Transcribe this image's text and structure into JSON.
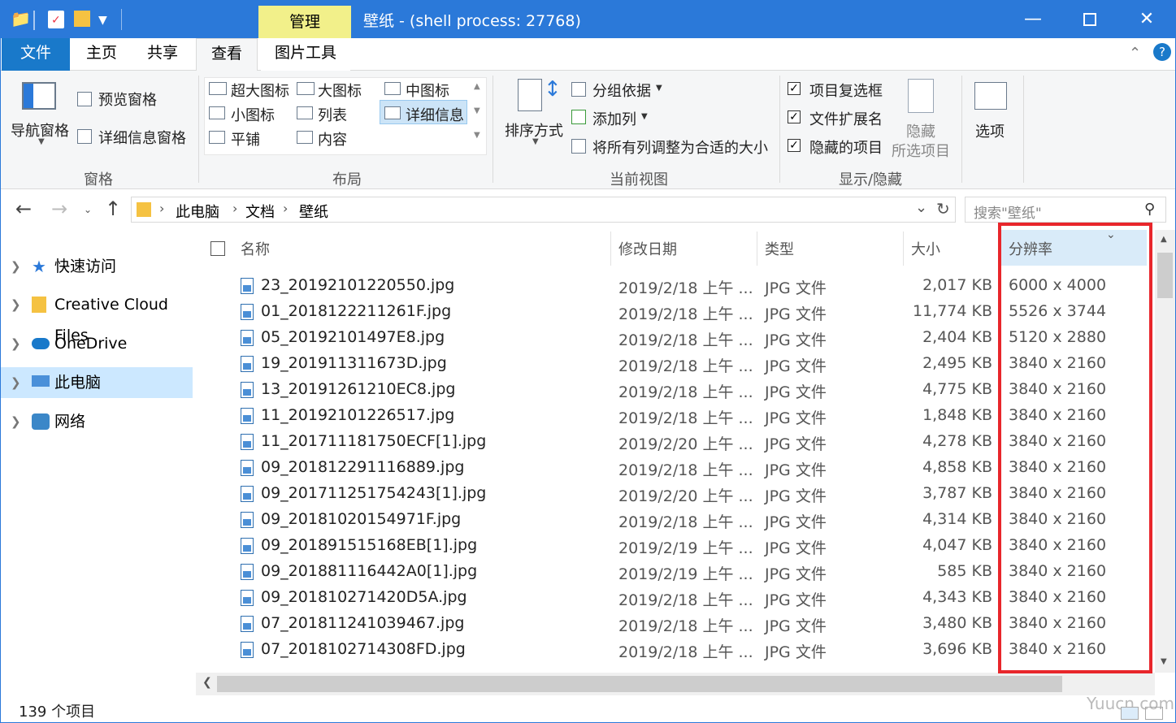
{
  "window": {
    "title": "壁纸 - (shell process: 27768)",
    "context_tab": "管理"
  },
  "tabs": [
    "文件",
    "主页",
    "共享",
    "查看",
    "图片工具"
  ],
  "ribbon": {
    "pane_group": {
      "nav_pane": "导航窗格",
      "preview_pane": "预览窗格",
      "details_pane": "详细信息窗格",
      "label": "窗格"
    },
    "layout_group": {
      "items": [
        "超大图标",
        "大图标",
        "中图标",
        "小图标",
        "列表",
        "详细信息",
        "平铺",
        "内容"
      ],
      "label": "布局"
    },
    "current_view_group": {
      "sort_by": "排序方式",
      "group_by": "分组依据",
      "add_columns": "添加列",
      "size_all_columns": "将所有列调整为合适的大小",
      "label": "当前视图"
    },
    "show_hide_group": {
      "item_checkboxes": "项目复选框",
      "file_extensions": "文件扩展名",
      "hidden_items": "隐藏的项目",
      "hide_selected_line1": "隐藏",
      "hide_selected_line2": "所选项目",
      "label": "显示/隐藏"
    },
    "options": "选项"
  },
  "address": {
    "breadcrumb": [
      "此电脑",
      "文档",
      "壁纸"
    ],
    "search_placeholder": "搜索\"壁纸\""
  },
  "nav": [
    {
      "label": "快速访问",
      "icon": "star-icon"
    },
    {
      "label": "Creative Cloud Files",
      "icon": "creative-cloud-icon"
    },
    {
      "label": "OneDrive",
      "icon": "cloud-icon"
    },
    {
      "label": "此电脑",
      "icon": "computer-icon",
      "selected": true
    },
    {
      "label": "网络",
      "icon": "network-icon"
    }
  ],
  "columns": {
    "name": "名称",
    "modified": "修改日期",
    "type": "类型",
    "size": "大小",
    "resolution": "分辨率"
  },
  "files": [
    {
      "name": "23_20192101220550.jpg",
      "date": "2019/2/18 上午 ...",
      "type": "JPG 文件",
      "size": "2,017 KB",
      "res": "6000 x 4000"
    },
    {
      "name": "01_2018122211261F.jpg",
      "date": "2019/2/18 上午 ...",
      "type": "JPG 文件",
      "size": "11,774 KB",
      "res": "5526 x 3744"
    },
    {
      "name": "05_20192101497E8.jpg",
      "date": "2019/2/18 上午 ...",
      "type": "JPG 文件",
      "size": "2,404 KB",
      "res": "5120 x 2880"
    },
    {
      "name": "19_201911311673D.jpg",
      "date": "2019/2/18 上午 ...",
      "type": "JPG 文件",
      "size": "2,495 KB",
      "res": "3840 x 2160"
    },
    {
      "name": "13_20191261210EC8.jpg",
      "date": "2019/2/18 上午 ...",
      "type": "JPG 文件",
      "size": "4,775 KB",
      "res": "3840 x 2160"
    },
    {
      "name": "11_20192101226517.jpg",
      "date": "2019/2/18 上午 ...",
      "type": "JPG 文件",
      "size": "1,848 KB",
      "res": "3840 x 2160"
    },
    {
      "name": "11_201711181750ECF[1].jpg",
      "date": "2019/2/20 上午 ...",
      "type": "JPG 文件",
      "size": "4,278 KB",
      "res": "3840 x 2160"
    },
    {
      "name": "09_201812291116889.jpg",
      "date": "2019/2/18 上午 ...",
      "type": "JPG 文件",
      "size": "4,858 KB",
      "res": "3840 x 2160"
    },
    {
      "name": "09_201711251754243[1].jpg",
      "date": "2019/2/20 上午 ...",
      "type": "JPG 文件",
      "size": "3,787 KB",
      "res": "3840 x 2160"
    },
    {
      "name": "09_20181020154971F.jpg",
      "date": "2019/2/18 上午 ...",
      "type": "JPG 文件",
      "size": "4,314 KB",
      "res": "3840 x 2160"
    },
    {
      "name": "09_201891515168EB[1].jpg",
      "date": "2019/2/19 上午 ...",
      "type": "JPG 文件",
      "size": "4,047 KB",
      "res": "3840 x 2160"
    },
    {
      "name": "09_201881116442A0[1].jpg",
      "date": "2019/2/19 上午 ...",
      "type": "JPG 文件",
      "size": "585 KB",
      "res": "3840 x 2160"
    },
    {
      "name": "09_201810271420D5A.jpg",
      "date": "2019/2/18 上午 ...",
      "type": "JPG 文件",
      "size": "4,343 KB",
      "res": "3840 x 2160"
    },
    {
      "name": "07_201811241039467.jpg",
      "date": "2019/2/18 上午 ...",
      "type": "JPG 文件",
      "size": "3,480 KB",
      "res": "3840 x 2160"
    },
    {
      "name": "07_2018102714308FD.jpg",
      "date": "2019/2/18 上午 ...",
      "type": "JPG 文件",
      "size": "3,696 KB",
      "res": "3840 x 2160"
    }
  ],
  "status": {
    "count": "139 个项目"
  },
  "watermark": "Yuucn.com",
  "colors": {
    "title_bar": "#2b79d9",
    "file_tab": "#1979ca",
    "highlight_box": "#e8262b",
    "context_tab": "#f2f08a"
  }
}
